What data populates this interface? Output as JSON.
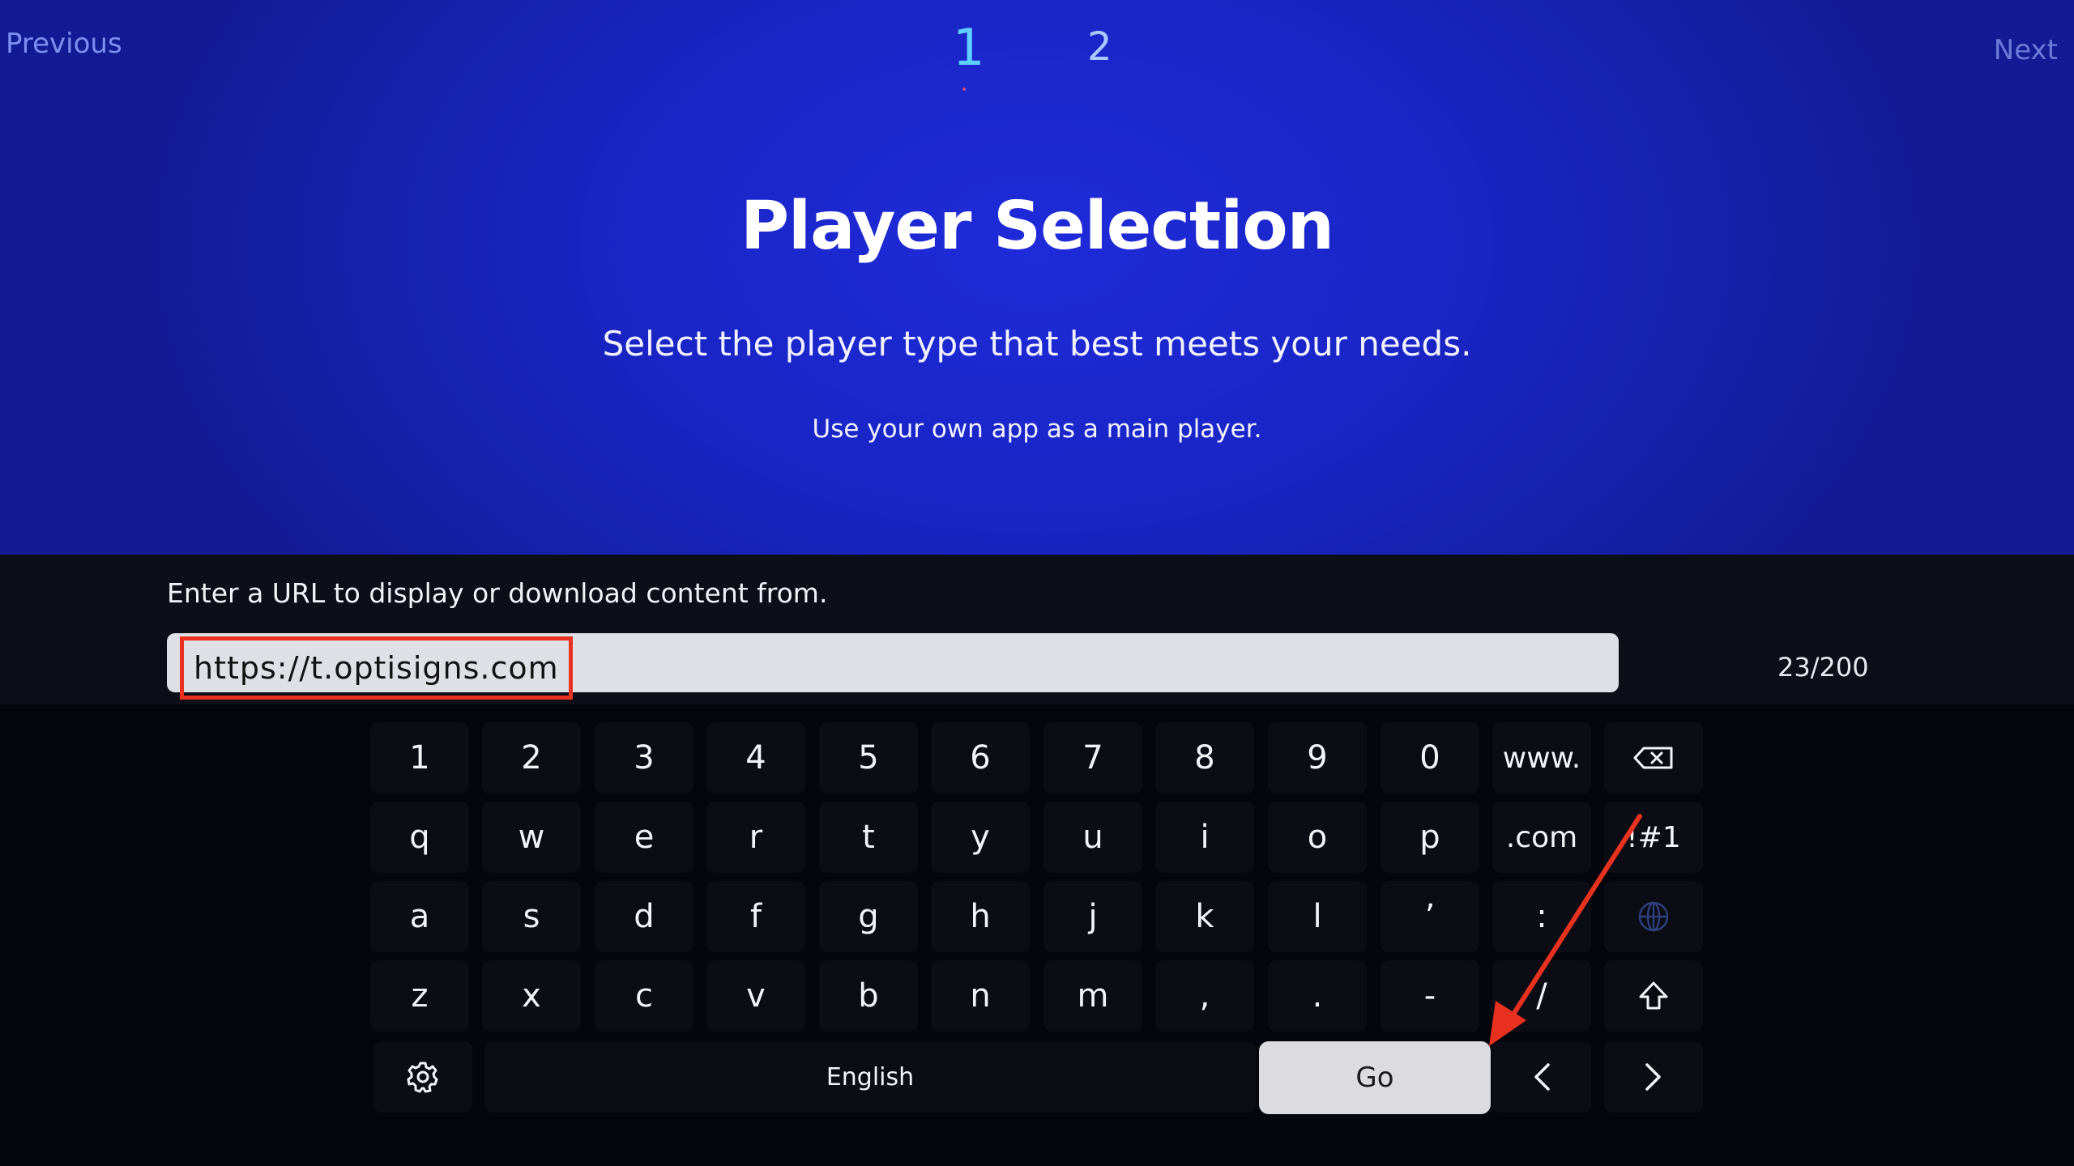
{
  "nav": {
    "previous_label": "Previous",
    "next_label": "Next",
    "steps": [
      "1",
      "2"
    ],
    "active_step": "1"
  },
  "header": {
    "title": "Player Selection",
    "subtitle": "Select the player type that best meets your needs.",
    "hint": "Use your own app as a main player."
  },
  "url_input": {
    "label": "Enter a URL to display or download content from.",
    "value": "https://t.optisigns.com",
    "char_count": "23/200"
  },
  "keyboard": {
    "rows": [
      [
        "1",
        "2",
        "3",
        "4",
        "5",
        "6",
        "7",
        "8",
        "9",
        "0",
        "www."
      ],
      [
        "q",
        "w",
        "e",
        "r",
        "t",
        "y",
        "u",
        "i",
        "o",
        "p",
        ".com",
        "!#1"
      ],
      [
        "a",
        "s",
        "d",
        "f",
        "g",
        "h",
        "j",
        "k",
        "l",
        "’",
        ":"
      ],
      [
        "z",
        "x",
        "c",
        "v",
        "b",
        "n",
        "m",
        ",",
        ".",
        "-",
        "/"
      ]
    ],
    "language_label": "English",
    "go_label": "Go"
  },
  "colors": {
    "panel_blue": "#1a25c6",
    "active_step": "#5fd0ff",
    "highlight_box": "#e8311f",
    "annotation_arrow": "#e8311f"
  },
  "icons": {
    "backspace": "backspace-icon",
    "globe": "globe-icon",
    "shift": "shift-icon",
    "settings": "gear-icon",
    "left": "chevron-left-icon",
    "right": "chevron-right-icon"
  }
}
